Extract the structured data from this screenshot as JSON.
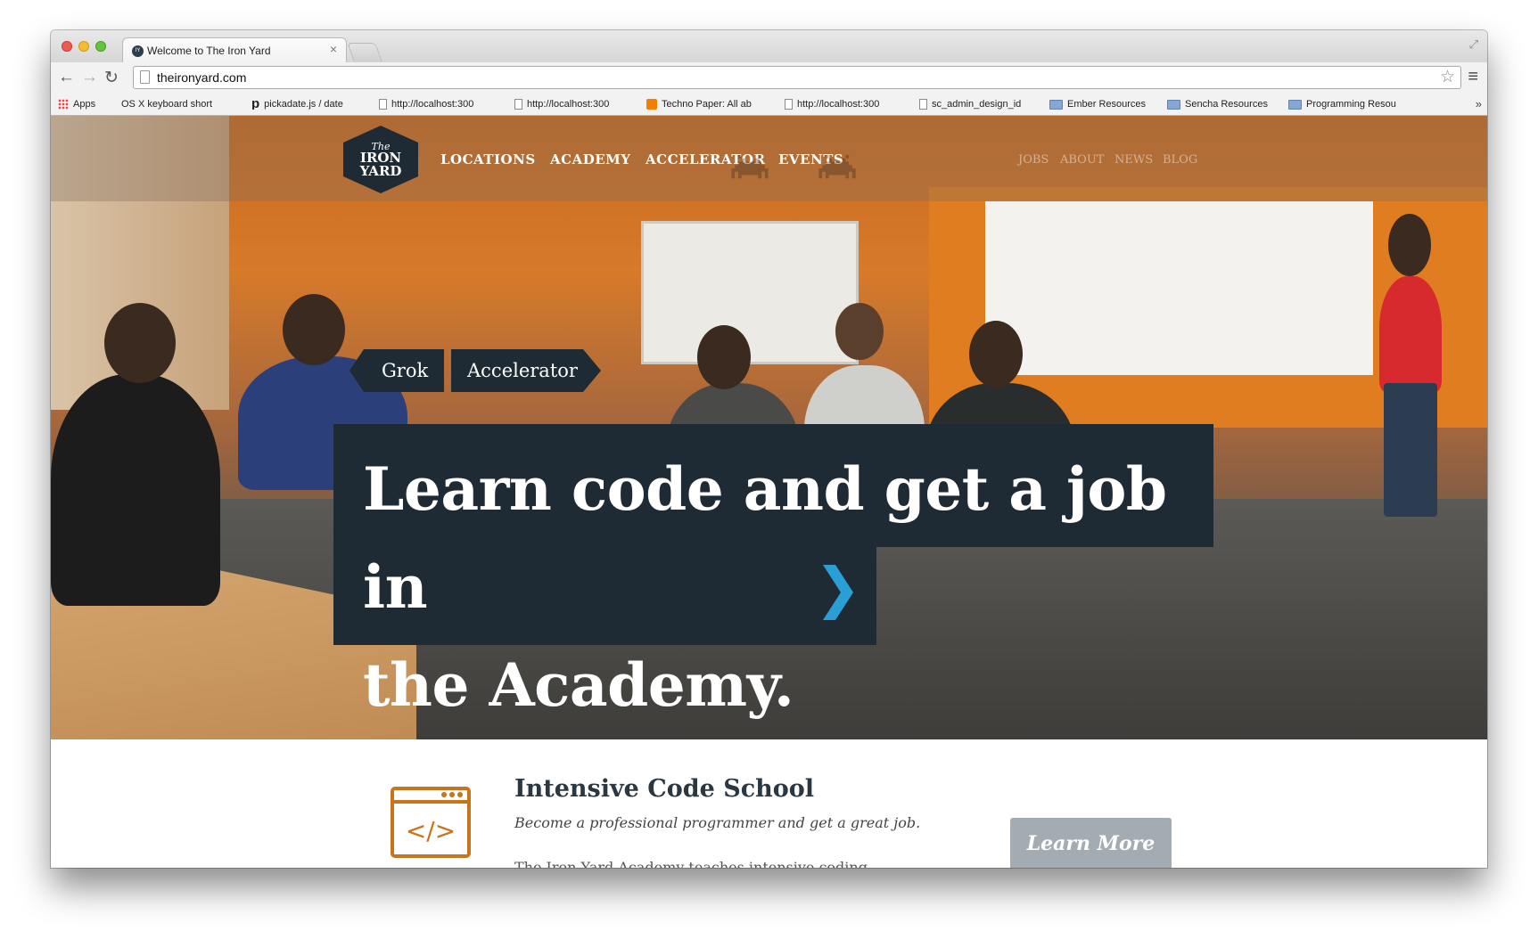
{
  "browser": {
    "tab_title": "Welcome to The Iron Yard",
    "tab_close": "×",
    "url": "theironyard.com",
    "bookmarks": [
      {
        "label": "Apps",
        "icon": "apps-icon"
      },
      {
        "label": "OS X keyboard short",
        "icon": "apple-icon"
      },
      {
        "label": "pickadate.js / date",
        "icon": "pickadate-icon"
      },
      {
        "label": "http://localhost:300",
        "icon": "page-icon"
      },
      {
        "label": "http://localhost:300",
        "icon": "page-icon"
      },
      {
        "label": "Techno Paper: All ab",
        "icon": "blogger-icon"
      },
      {
        "label": "http://localhost:300",
        "icon": "page-icon"
      },
      {
        "label": "sc_admin_design_id",
        "icon": "page-icon"
      },
      {
        "label": "Ember Resources",
        "icon": "folder-icon"
      },
      {
        "label": "Sencha Resources",
        "icon": "folder-icon"
      },
      {
        "label": "Programming Resou",
        "icon": "folder-icon"
      }
    ],
    "more_bookmarks": "»"
  },
  "site": {
    "logo": {
      "the": "The",
      "iron": "IRON",
      "yard": "YARD"
    },
    "nav_main": [
      "LOCATIONS",
      "ACADEMY",
      "ACCELERATOR",
      "EVENTS"
    ],
    "nav_secondary": [
      "JOBS",
      "ABOUT",
      "NEWS",
      "BLOG"
    ],
    "hero": {
      "pill_grok": "Grok",
      "pill_accelerator": "Accelerator",
      "headline_line1": "Learn code and get a job in",
      "headline_line2": "the Academy."
    },
    "feature": {
      "title": "Intensive Code School",
      "subtitle": "Become a professional programmer and get a great job.",
      "cut_text": "The Iron Yard Academy teaches intensive coding courses to",
      "button": "Learn More"
    }
  },
  "colors": {
    "dark_navy": "#1f2b34",
    "accent_blue": "#2a9fd6",
    "icon_orange": "#c8741c",
    "button_gray": "#a4acb3"
  }
}
